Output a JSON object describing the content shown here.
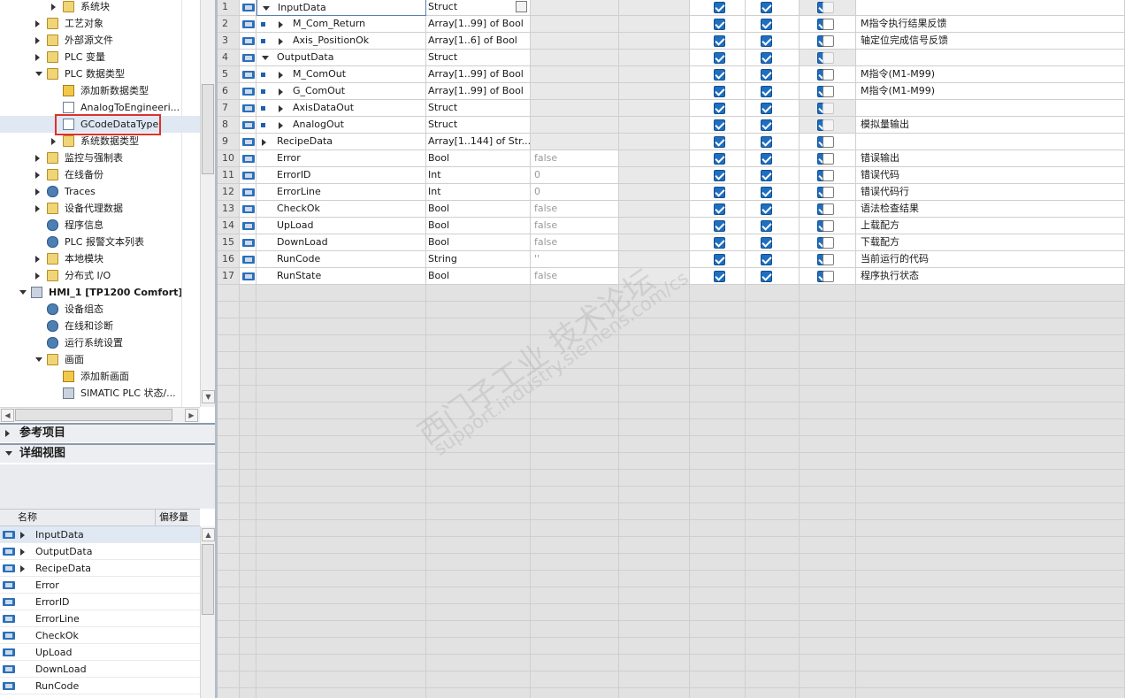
{
  "tree": {
    "items": [
      {
        "label": "系统块",
        "level": 3,
        "state": "collapsed"
      },
      {
        "label": "工艺对象",
        "level": 2,
        "state": "collapsed"
      },
      {
        "label": "外部源文件",
        "level": 2,
        "state": "collapsed"
      },
      {
        "label": "PLC 变量",
        "level": 2,
        "state": "collapsed"
      },
      {
        "label": "PLC 数据类型",
        "level": 2,
        "state": "expanded"
      },
      {
        "label": "添加新数据类型",
        "level": 3,
        "state": "none"
      },
      {
        "label": "AnalogToEngineeri...",
        "level": 3,
        "state": "none"
      },
      {
        "label": "GCodeDataType",
        "level": 3,
        "state": "none"
      },
      {
        "label": "系统数据类型",
        "level": 3,
        "state": "collapsed"
      },
      {
        "label": "监控与强制表",
        "level": 2,
        "state": "collapsed"
      },
      {
        "label": "在线备份",
        "level": 2,
        "state": "collapsed"
      },
      {
        "label": "Traces",
        "level": 2,
        "state": "collapsed"
      },
      {
        "label": "设备代理数据",
        "level": 2,
        "state": "collapsed"
      },
      {
        "label": "程序信息",
        "level": 2,
        "state": "none"
      },
      {
        "label": "PLC 报警文本列表",
        "level": 2,
        "state": "none"
      },
      {
        "label": "本地模块",
        "level": 2,
        "state": "collapsed"
      },
      {
        "label": "分布式 I/O",
        "level": 2,
        "state": "collapsed"
      },
      {
        "label": "HMI_1 [TP1200 Comfort]",
        "level": 1,
        "state": "expanded"
      },
      {
        "label": "设备组态",
        "level": 2,
        "state": "none"
      },
      {
        "label": "在线和诊断",
        "level": 2,
        "state": "none"
      },
      {
        "label": "运行系统设置",
        "level": 2,
        "state": "none"
      },
      {
        "label": "画面",
        "level": 2,
        "state": "expanded"
      },
      {
        "label": "添加新画面",
        "level": 3,
        "state": "none"
      },
      {
        "label": "SIMATIC PLC 状态/...",
        "level": 3,
        "state": "none"
      }
    ]
  },
  "sections": {
    "references": "参考项目",
    "details": "详细视图"
  },
  "detail_view": {
    "headers": {
      "name": "名称",
      "offset": "偏移量"
    },
    "rows": [
      "InputData",
      "OutputData",
      "RecipeData",
      "Error",
      "ErrorID",
      "ErrorLine",
      "CheckOk",
      "UpLoad",
      "DownLoad",
      "RunCode"
    ],
    "expandable": [
      true,
      true,
      true,
      false,
      false,
      false,
      false,
      false,
      false,
      false
    ]
  },
  "table": {
    "rows": [
      {
        "num": "1",
        "name": "InputData",
        "type": "Struct",
        "default": "",
        "c1": true,
        "c2": true,
        "c3": true,
        "c4": "dim",
        "comment": "",
        "indent": 0,
        "expander": "expanded"
      },
      {
        "num": "2",
        "name": "M_Com_Return",
        "type": "Array[1..99] of Bool",
        "default": "",
        "c1": true,
        "c2": true,
        "c3": true,
        "c4": "off",
        "comment": "M指令执行结果反馈",
        "indent": 1,
        "expander": "collapsed"
      },
      {
        "num": "3",
        "name": "Axis_PositionOk",
        "type": "Array[1..6] of Bool",
        "default": "",
        "c1": true,
        "c2": true,
        "c3": true,
        "c4": "off",
        "comment": "轴定位完成信号反馈",
        "indent": 1,
        "expander": "collapsed"
      },
      {
        "num": "4",
        "name": "OutputData",
        "type": "Struct",
        "default": "",
        "c1": true,
        "c2": true,
        "c3": true,
        "c4": "dim",
        "comment": "",
        "indent": 0,
        "expander": "expanded"
      },
      {
        "num": "5",
        "name": "M_ComOut",
        "type": "Array[1..99] of Bool",
        "default": "",
        "c1": true,
        "c2": true,
        "c3": true,
        "c4": "off",
        "comment": "M指令(M1-M99)",
        "indent": 1,
        "expander": "collapsed"
      },
      {
        "num": "6",
        "name": "G_ComOut",
        "type": "Array[1..99] of Bool",
        "default": "",
        "c1": true,
        "c2": true,
        "c3": true,
        "c4": "off",
        "comment": "M指令(M1-M99)",
        "indent": 1,
        "expander": "collapsed"
      },
      {
        "num": "7",
        "name": "AxisDataOut",
        "type": "Struct",
        "default": "",
        "c1": true,
        "c2": true,
        "c3": true,
        "c4": "dim",
        "comment": "",
        "indent": 1,
        "expander": "collapsed"
      },
      {
        "num": "8",
        "name": "AnalogOut",
        "type": "Struct",
        "default": "",
        "c1": true,
        "c2": true,
        "c3": true,
        "c4": "dim",
        "comment": "模拟量输出",
        "indent": 1,
        "expander": "collapsed"
      },
      {
        "num": "9",
        "name": "RecipeData",
        "type": "Array[1..144] of Str...",
        "default": "",
        "c1": true,
        "c2": true,
        "c3": true,
        "c4": "off",
        "comment": "",
        "indent": 0,
        "expander": "collapsed"
      },
      {
        "num": "10",
        "name": "Error",
        "type": "Bool",
        "default": "false",
        "c1": true,
        "c2": true,
        "c3": true,
        "c4": "off",
        "comment": "错误输出",
        "indent": 0,
        "expander": "none"
      },
      {
        "num": "11",
        "name": "ErrorID",
        "type": "Int",
        "default": "0",
        "c1": true,
        "c2": true,
        "c3": true,
        "c4": "off",
        "comment": "错误代码",
        "indent": 0,
        "expander": "none"
      },
      {
        "num": "12",
        "name": "ErrorLine",
        "type": "Int",
        "default": "0",
        "c1": true,
        "c2": true,
        "c3": true,
        "c4": "off",
        "comment": "错误代码行",
        "indent": 0,
        "expander": "none"
      },
      {
        "num": "13",
        "name": "CheckOk",
        "type": "Bool",
        "default": "false",
        "c1": true,
        "c2": true,
        "c3": true,
        "c4": "off",
        "comment": "语法检查结果",
        "indent": 0,
        "expander": "none"
      },
      {
        "num": "14",
        "name": "UpLoad",
        "type": "Bool",
        "default": "false",
        "c1": true,
        "c2": true,
        "c3": true,
        "c4": "off",
        "comment": "上载配方",
        "indent": 0,
        "expander": "none"
      },
      {
        "num": "15",
        "name": "DownLoad",
        "type": "Bool",
        "default": "false",
        "c1": true,
        "c2": true,
        "c3": true,
        "c4": "off",
        "comment": "下载配方",
        "indent": 0,
        "expander": "none"
      },
      {
        "num": "16",
        "name": "RunCode",
        "type": "String",
        "default": "''",
        "c1": true,
        "c2": true,
        "c3": true,
        "c4": "off",
        "comment": "当前运行的代码",
        "indent": 0,
        "expander": "none"
      },
      {
        "num": "17",
        "name": "RunState",
        "type": "Bool",
        "default": "false",
        "c1": true,
        "c2": true,
        "c3": true,
        "c4": "off",
        "comment": "程序执行状态",
        "indent": 0,
        "expander": "none"
      }
    ]
  },
  "watermark": {
    "line1": "西门子工业 技术论坛",
    "line2": "support.industry.siemens.com/cs"
  },
  "colors": {
    "checkbox_checked": "#1f6ec0",
    "highlight_box": "#e0302a",
    "splitter": "#b4bdc9"
  }
}
